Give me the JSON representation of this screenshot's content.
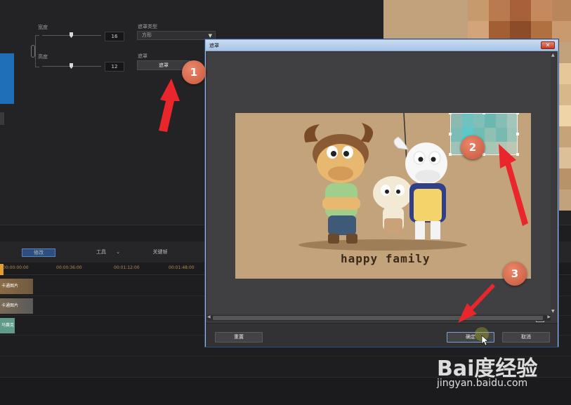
{
  "editor": {
    "width_label": "宽度",
    "height_label": "高度",
    "width_value": "16",
    "height_value": "12",
    "mask_type_label": "遮罩类型",
    "mask_type_value": "方形",
    "mask_label": "遮罩",
    "mask_button": "遮罩"
  },
  "timeline": {
    "modify_button": "修改",
    "tools_button": "工具",
    "keyframe_button": "关键帧",
    "ruler_ticks": [
      "00:00:00:00",
      "00:00:36:00",
      "00:01:12:00",
      "00:01:48:00"
    ],
    "clips": [
      "卡通图片",
      "卡通图片",
      "马赛克"
    ]
  },
  "dialog": {
    "title": "遮罩",
    "close_glyph": "✕",
    "caption": "happy family",
    "reset_button": "重置",
    "ok_button": "确定",
    "cancel_button": "取消"
  },
  "annotations": {
    "badges": [
      "1",
      "2",
      "3"
    ],
    "arrow_color": "#e8262b"
  },
  "watermark": {
    "logo": "Bai度经验",
    "url": "jingyan.baidu.com"
  },
  "colors": {
    "dialog_border": "#9eb9d9",
    "badge": "#d4654a",
    "image_bg": "#c3a37b"
  }
}
